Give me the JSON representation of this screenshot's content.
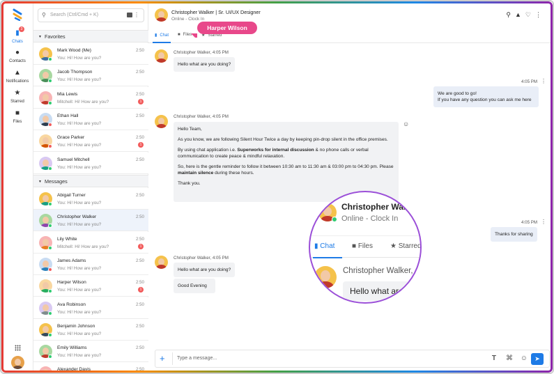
{
  "rail": {
    "items": [
      {
        "label": "Chats",
        "icon": "chat-icon",
        "badge": "3"
      },
      {
        "label": "Contacts",
        "icon": "contacts-icon"
      },
      {
        "label": "Notifications",
        "icon": "bell-icon"
      },
      {
        "label": "Starred",
        "icon": "star-icon"
      },
      {
        "label": "Files",
        "icon": "folder-icon"
      }
    ]
  },
  "search": {
    "placeholder": "Search (Ctrl/Cmd + K)"
  },
  "sections": {
    "favorites": "Favorites",
    "messages": "Messages"
  },
  "favorites": [
    {
      "name": "Mark Wood (Me)",
      "msg": "You: Hi! How are you?",
      "time": "2:50",
      "status": "on",
      "unread": ""
    },
    {
      "name": "Jacob Thompson",
      "msg": "You: Hi! How are you?",
      "time": "2:50",
      "status": "on",
      "unread": ""
    },
    {
      "name": "Mia Lewis",
      "msg": "Mitchell: Hi! How are you?",
      "time": "2:50",
      "status": "on",
      "unread": "1"
    },
    {
      "name": "Ethan Hall",
      "msg": "You: Hi! How are you?",
      "time": "2:50",
      "status": "off",
      "unread": ""
    },
    {
      "name": "Grace Parker",
      "msg": "You: Hi! How are you?",
      "time": "2:50",
      "status": "off",
      "unread": "1"
    },
    {
      "name": "Samuel Mitchell",
      "msg": "You: Hi! How are you?",
      "time": "2:50",
      "status": "on",
      "unread": ""
    }
  ],
  "messages_list": [
    {
      "name": "Abigail Turner",
      "msg": "You: Hi! How are you?",
      "time": "2:50",
      "status": "on",
      "unread": ""
    },
    {
      "name": "Christopher Walker",
      "msg": "You: Hi! How are you?",
      "time": "2:50",
      "status": "on",
      "unread": ""
    },
    {
      "name": "Lily White",
      "msg": "Mitchell: Hi! How are you?",
      "time": "2:50",
      "status": "on",
      "unread": "1"
    },
    {
      "name": "James Adams",
      "msg": "You: Hi! How are you?",
      "time": "2:50",
      "status": "off",
      "unread": ""
    },
    {
      "name": "Harper Wilson",
      "msg": "You: Hi! How are you?",
      "time": "2:50",
      "status": "on",
      "unread": "1"
    },
    {
      "name": "Ava Robinson",
      "msg": "You: Hi! How are you?",
      "time": "2:50",
      "status": "on",
      "unread": ""
    },
    {
      "name": "Benjamin Johnson",
      "msg": "You: Hi! How are you?",
      "time": "2:50",
      "status": "on",
      "unread": ""
    },
    {
      "name": "Emily Williams",
      "msg": "You: Hi! How are you?",
      "time": "2:50",
      "status": "on",
      "unread": ""
    },
    {
      "name": "Alexander Davis",
      "msg": "",
      "time": "2:50",
      "status": "on",
      "unread": ""
    }
  ],
  "header": {
    "title": "Christopher Walker | Sr. UI/UX Designer",
    "status": "Online - Clock In",
    "icons": [
      "search-icon",
      "bell-icon",
      "heart-icon",
      "more-icon"
    ]
  },
  "tabs": [
    {
      "label": "Chat",
      "icon": "chat-icon"
    },
    {
      "label": "Files",
      "icon": "folder-icon"
    },
    {
      "label": "Starred",
      "icon": "star-icon"
    }
  ],
  "tooltip": "Harper Wilson",
  "chat": {
    "m1_head": "Christopher Walker, 4:05 PM",
    "m1_text": "Hello what are you doing?",
    "o1_time": "4:05 PM",
    "o1_line1": "We are good to go!",
    "o1_line2": "If you have any question you can ask me here",
    "m2_head": "Christopher Walker, 4:05 PM",
    "m2_p1": "Hello Team,",
    "m2_p2": "As you know, we are following Silent Hour Twice a day by keeping pin-drop silent in the office premises.",
    "m2_p3a": "By using chat application i.e. ",
    "m2_p3b": "Superworks for internal discussion",
    "m2_p3c": " & no phone calls or verbal communication to create peace & mindful relaxation.",
    "m2_p4a": "So, here is the gentle reminder to follow it between 10:30 am to 11:30 am & 03:00 pm to 04:30 pm. Please ",
    "m2_p4b": "maintain silence",
    "m2_p4c": " during these hours.",
    "m2_p5": "Thank you.",
    "o2_time": "4:05 PM",
    "o2_text": "Thanks for sharing",
    "m3_head": "Christopher Walker, 4:05 PM",
    "m3_text1": "Hello what are you doing?",
    "m3_text2": "Good Evening"
  },
  "composer": {
    "placeholder": "Type a message...",
    "icons": [
      "text-format-icon",
      "attach-icon",
      "emoji-icon",
      "send-icon"
    ]
  },
  "magnifier": {
    "name": "Christopher Walker",
    "status": "Online - Clock In",
    "tab_chat": "Chat",
    "tab_files": "Files",
    "tab_starred": "Starred",
    "msg_head": "Christopher Walker,",
    "msg_text": "Hello what are"
  },
  "colors": {
    "accent": "#1e7be6",
    "tooltip": "#e8488a",
    "magnifier_ring": "#9b4fd8",
    "online": "#2ecc71",
    "unread": "#f25c5c"
  }
}
